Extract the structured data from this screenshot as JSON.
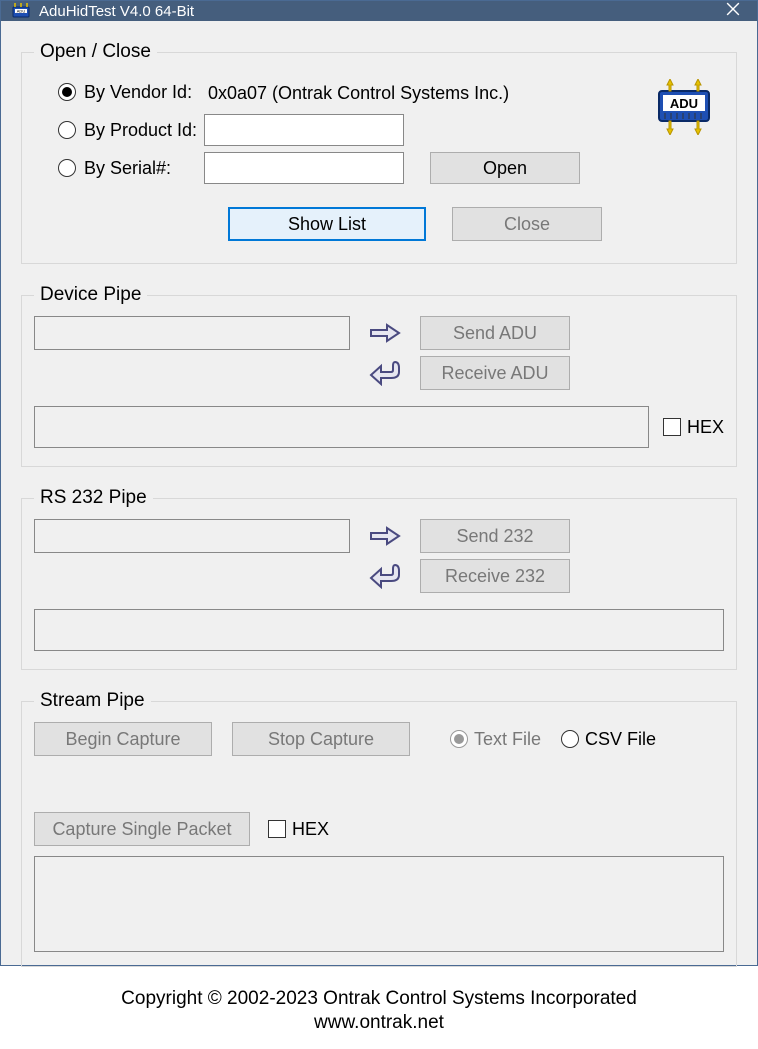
{
  "window": {
    "title": "AduHidTest V4.0 64-Bit"
  },
  "open_close": {
    "legend": "Open / Close",
    "by_vendor_label": "By Vendor Id:",
    "vendor_value": "0x0a07 (Ontrak Control Systems Inc.)",
    "by_product_label": "By Product Id:",
    "product_value": "",
    "by_serial_label": "By Serial#:",
    "serial_value": "",
    "open_btn": "Open",
    "close_btn": "Close",
    "show_list_btn": "Show List"
  },
  "device_pipe": {
    "legend": "Device Pipe",
    "send_btn": "Send ADU",
    "receive_btn": "Receive ADU",
    "hex_label": "HEX"
  },
  "rs232_pipe": {
    "legend": "RS 232 Pipe",
    "send_btn": "Send 232",
    "receive_btn": "Receive 232"
  },
  "stream_pipe": {
    "legend": "Stream Pipe",
    "begin_btn": "Begin Capture",
    "stop_btn": "Stop Capture",
    "text_file_label": "Text File",
    "csv_file_label": "CSV File",
    "single_packet_btn": "Capture Single Packet",
    "hex_label": "HEX"
  },
  "footer": {
    "line1": "Copyright © 2002-2023 Ontrak Control Systems Incorporated",
    "line2": "www.ontrak.net"
  }
}
